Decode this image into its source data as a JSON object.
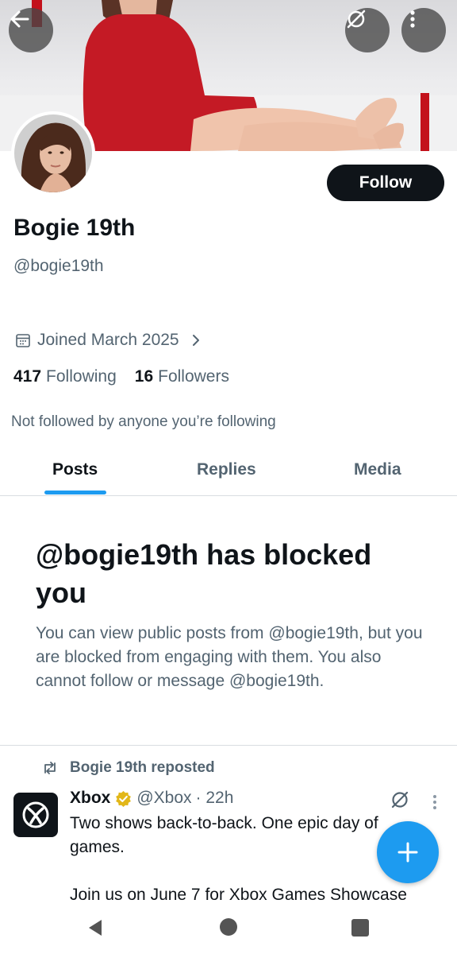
{
  "profile": {
    "display_name": "Bogie 19th",
    "handle": "@bogie19th",
    "follow_label": "Follow",
    "joined": "Joined March 2025",
    "following_count": "417",
    "following_label": "Following",
    "followers_count": "16",
    "followers_label": "Followers",
    "not_followed_note": "Not followed by anyone you’re following"
  },
  "tabs": [
    {
      "label": "Posts",
      "active": true
    },
    {
      "label": "Replies",
      "active": false
    },
    {
      "label": "Media",
      "active": false
    }
  ],
  "blocked": {
    "title": "@bogie19th has blocked you",
    "description": "You can view public posts from @bogie19th, but you are blocked from engaging with them. You also cannot follow or message @bogie19th."
  },
  "repost": {
    "label": "Bogie 19th reposted",
    "author_name": "Xbox",
    "author_handle": "@Xbox",
    "time": "· 22h",
    "lines": [
      "Two shows back-to-back. One epic day of",
      "games.",
      "",
      "Join us on June 7 for Xbox Games Showcase"
    ]
  },
  "icons": {
    "back": "arrow-left-icon",
    "grok": "grok-icon",
    "more": "more-vertical-icon",
    "calendar": "calendar-icon",
    "repost": "repost-icon",
    "verified": "verified-badge-icon",
    "compose": "plus-icon"
  },
  "colors": {
    "accent": "#1d9bf0",
    "text_primary": "#0f1419",
    "text_secondary": "#536471",
    "verified_gold": "#e2b719"
  }
}
